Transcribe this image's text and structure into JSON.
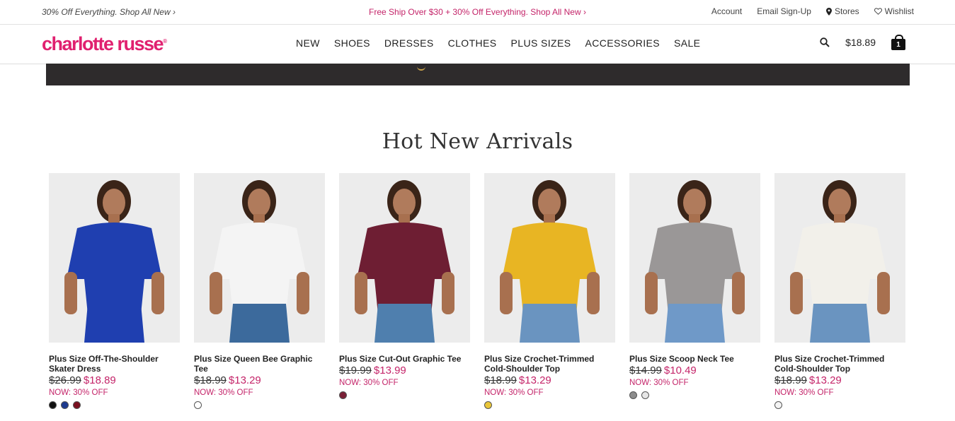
{
  "topbar": {
    "left": "30% Off Everything. Shop All New ›",
    "center": "Free Ship Over $30 + 30% Off Everything. Shop All New ›",
    "account": "Account",
    "email": "Email Sign-Up",
    "stores": "Stores",
    "wishlist": "Wishlist"
  },
  "header": {
    "logo": "charlotte russe",
    "nav": [
      "NEW",
      "SHOES",
      "DRESSES",
      "CLOTHES",
      "PLUS SIZES",
      "ACCESSORIES",
      "SALE"
    ],
    "cart_total": "$18.89",
    "cart_count": "1",
    "icons": [
      "search-icon",
      "shopping-bag-icon",
      "map-pin-icon",
      "heart-icon"
    ]
  },
  "section": {
    "title": "Hot New Arrivals"
  },
  "products": [
    {
      "name": "Plus Size Off-The-Shoulder Skater Dress",
      "was": "$26.99",
      "now": "$18.89",
      "off": "NOW: 30% OFF",
      "colors": [
        "#111111",
        "#1d3a8f",
        "#7a1020"
      ],
      "garment": "#1f3fb0",
      "bottom": "#1f3fb0"
    },
    {
      "name": "Plus Size Queen Bee Graphic Tee",
      "was": "$18.99",
      "now": "$13.29",
      "off": "NOW: 30% OFF",
      "colors": [
        "#ffffff"
      ],
      "garment": "#f4f4f4",
      "bottom": "#3c6a9c"
    },
    {
      "name": "Plus Size Cut-Out Graphic Tee",
      "was": "$19.99",
      "now": "$13.99",
      "off": "NOW: 30% OFF",
      "colors": [
        "#7a2036"
      ],
      "garment": "#6e1e33",
      "bottom": "#4f7fae"
    },
    {
      "name": "Plus Size Crochet-Trimmed Cold-Shoulder Top",
      "was": "$18.99",
      "now": "$13.29",
      "off": "NOW: 30% OFF",
      "colors": [
        "#e9c639"
      ],
      "garment": "#e8b523",
      "bottom": "#6a94c0"
    },
    {
      "name": "Plus Size Scoop Neck Tee",
      "was": "$14.99",
      "now": "$10.49",
      "off": "NOW: 30% OFF",
      "colors": [
        "#8c8c8c",
        "#e6e6e6"
      ],
      "garment": "#9a9797",
      "bottom": "#6f99c8"
    },
    {
      "name": "Plus Size Crochet-Trimmed Cold-Shoulder Top",
      "was": "$18.99",
      "now": "$13.29",
      "off": "NOW: 30% OFF",
      "colors": [
        "#f4f4f4"
      ],
      "garment": "#f2f0ea",
      "bottom": "#6a94c0"
    }
  ]
}
